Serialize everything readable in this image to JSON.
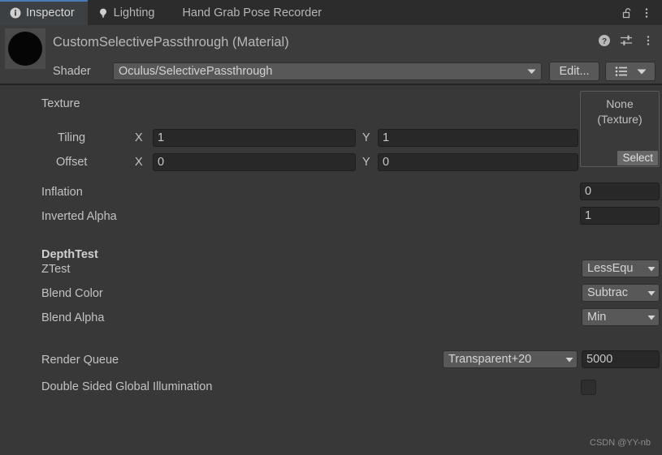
{
  "tabs": [
    {
      "label": "Inspector",
      "icon": "info-icon",
      "active": true
    },
    {
      "label": "Lighting",
      "icon": "bulb-icon",
      "active": false
    },
    {
      "label": "Hand Grab Pose Recorder",
      "icon": "",
      "active": false
    }
  ],
  "tabbar_actions": {
    "lock": "lock-open-icon",
    "menu": "kebab-menu-icon"
  },
  "header": {
    "title": "CustomSelectivePassthrough (Material)",
    "preview": "material-sphere-preview",
    "help_icon": "help-icon",
    "preset_icon": "preset-icon",
    "menu_icon": "kebab-menu-icon",
    "shader_label": "Shader",
    "shader_value": "Oculus/SelectivePassthrough",
    "edit_label": "Edit...",
    "list_icon": "list-icon"
  },
  "texture": {
    "section_label": "Texture",
    "tiling_label": "Tiling",
    "offset_label": "Offset",
    "x_label": "X",
    "y_label": "Y",
    "tiling_x": "1",
    "tiling_y": "1",
    "offset_x": "0",
    "offset_y": "0",
    "slot_line1": "None",
    "slot_line2": "(Texture)",
    "select_label": "Select"
  },
  "properties": {
    "inflation_label": "Inflation",
    "inflation_value": "0",
    "inverted_alpha_label": "Inverted Alpha",
    "inverted_alpha_value": "1"
  },
  "depth": {
    "header_label": "DepthTest",
    "ztest_label": "ZTest",
    "ztest_value": "LessEqu",
    "blend_color_label": "Blend Color",
    "blend_color_value": "Subtrac",
    "blend_alpha_label": "Blend Alpha",
    "blend_alpha_value": "Min"
  },
  "render": {
    "queue_label": "Render Queue",
    "queue_dropdown": "Transparent+20",
    "queue_value": "5000",
    "dsgi_label": "Double Sided Global Illumination",
    "dsgi_checked": false
  },
  "watermark": "CSDN @YY-nb",
  "colors": {
    "window_bg": "#383838",
    "tabbar_bg": "#2c2c2c",
    "tab_active_bg": "#3c4043",
    "tab_accent": "#4a7ab5",
    "header_bg": "#3c3c3c",
    "field_bg": "#282828",
    "control_bg": "#585858",
    "text": "#c2c2c2"
  }
}
